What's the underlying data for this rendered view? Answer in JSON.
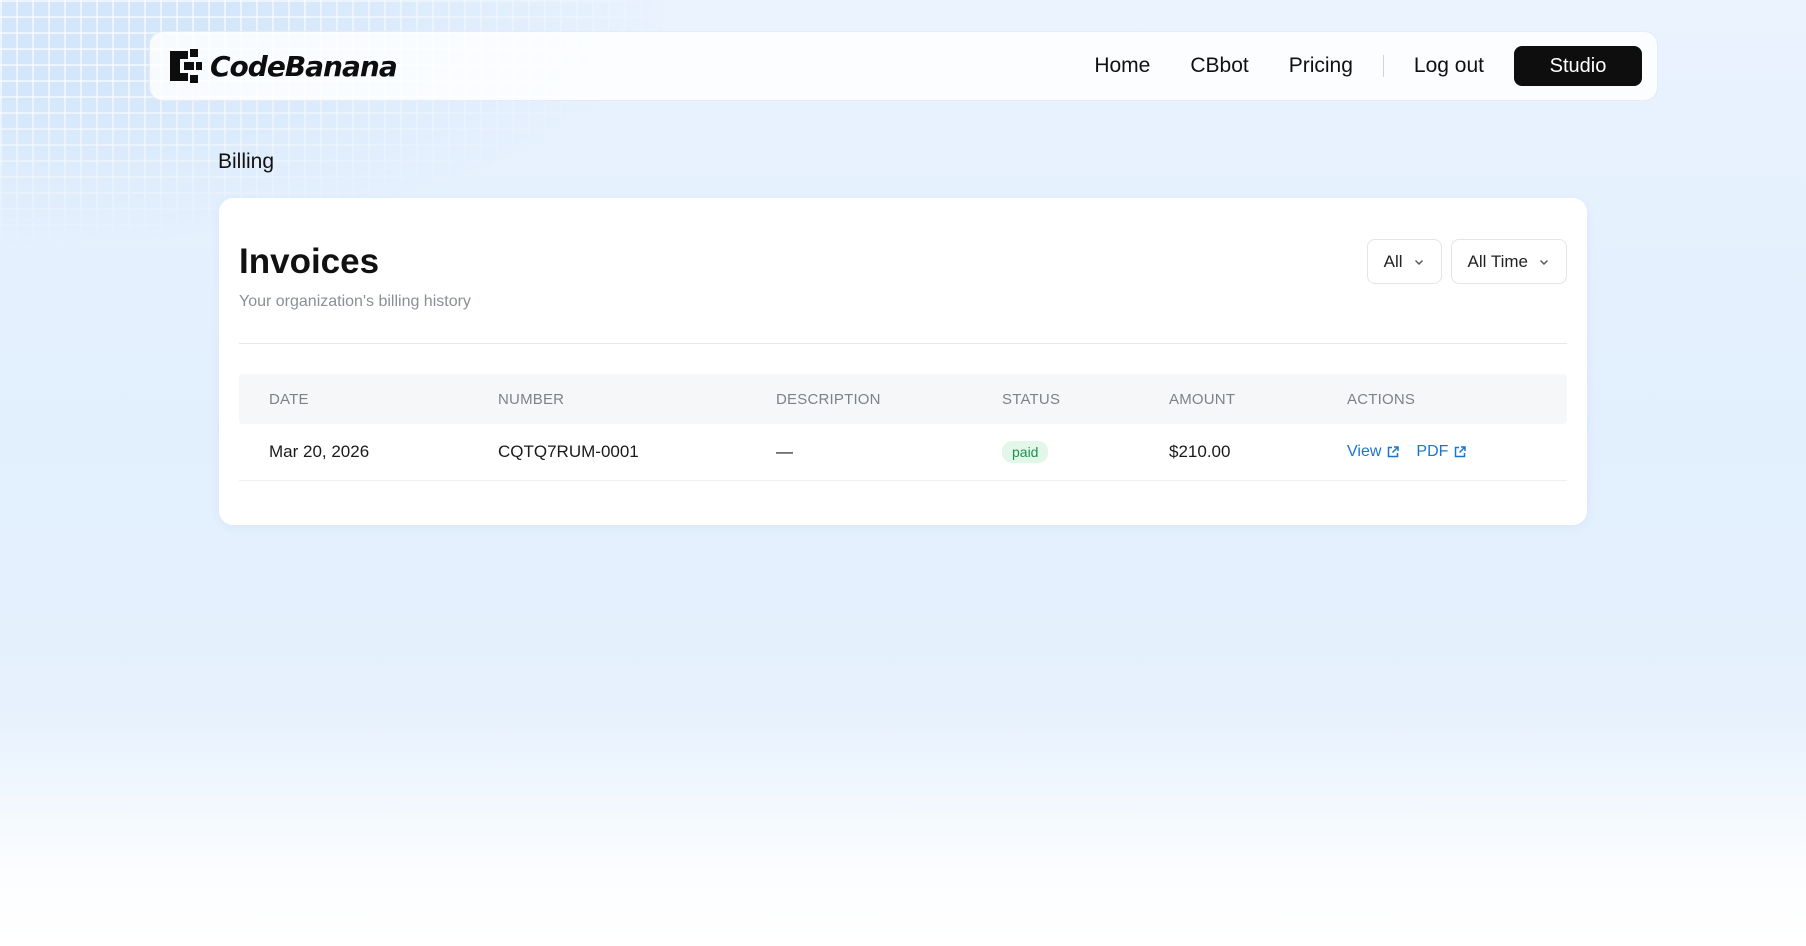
{
  "brand": {
    "name": "CodeBanana",
    "logo_icon": "codebanana-logo-icon"
  },
  "nav": {
    "links": [
      "Home",
      "CBbot",
      "Pricing"
    ],
    "logout": "Log out",
    "studio": "Studio"
  },
  "page": {
    "section": "Billing"
  },
  "invoices": {
    "title": "Invoices",
    "subtitle": "Your organization's billing history",
    "filters": {
      "status": "All",
      "period": "All Time"
    },
    "columns": [
      "DATE",
      "NUMBER",
      "DESCRIPTION",
      "STATUS",
      "AMOUNT",
      "ACTIONS"
    ],
    "rows": [
      {
        "date": "Mar 20, 2026",
        "number": "CQTQ7RUM-0001",
        "description": "—",
        "status": "paid",
        "amount": "$210.00",
        "actions": [
          "View",
          "PDF"
        ]
      }
    ]
  },
  "colors": {
    "primary_button": "#0e0e0e",
    "link": "#1677d2",
    "paid_badge_bg": "#e2f6ea",
    "paid_badge_text": "#1f8f4e"
  }
}
